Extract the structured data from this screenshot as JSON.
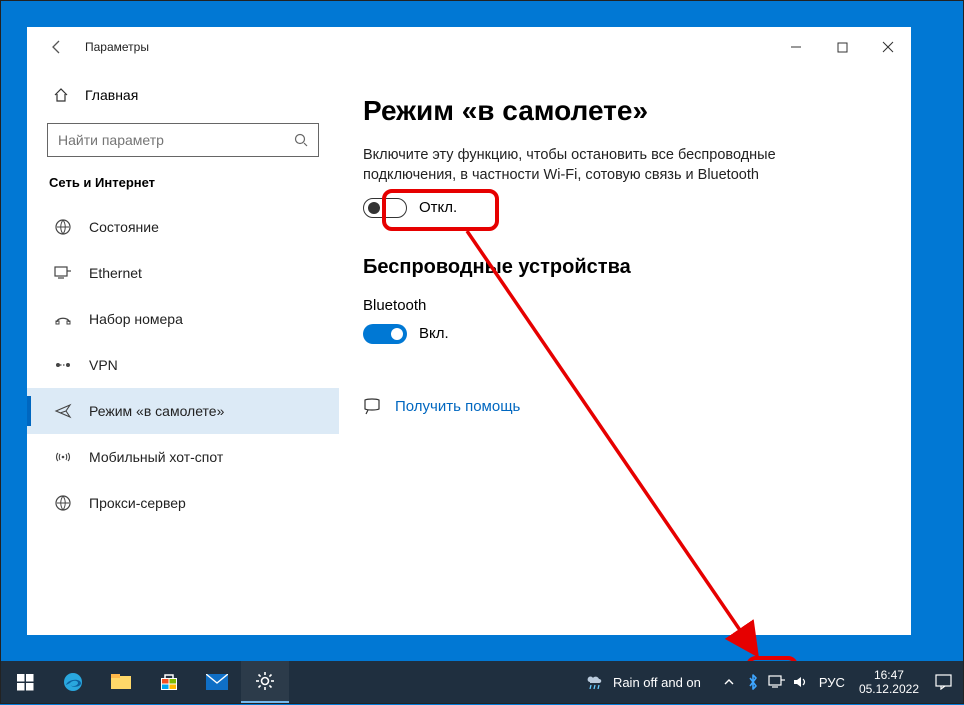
{
  "window": {
    "title": "Параметры"
  },
  "sidebar": {
    "home": "Главная",
    "search_placeholder": "Найти параметр",
    "group": "Сеть и Интернет",
    "items": [
      {
        "label": "Состояние"
      },
      {
        "label": "Ethernet"
      },
      {
        "label": "Набор номера"
      },
      {
        "label": "VPN"
      },
      {
        "label": "Режим «в самолете»"
      },
      {
        "label": "Мобильный хот-спот"
      },
      {
        "label": "Прокси-сервер"
      }
    ]
  },
  "content": {
    "title": "Режим «в самолете»",
    "desc": "Включите эту функцию, чтобы остановить все беспроводные подключения, в частности Wi-Fi, сотовую связь и Bluetooth",
    "airplane_toggle_label": "Откл.",
    "section_wireless": "Беспроводные устройства",
    "bluetooth_label": "Bluetooth",
    "bluetooth_toggle_label": "Вкл.",
    "help_link": "Получить помощь"
  },
  "taskbar": {
    "weather": "Rain off and on",
    "lang": "РУС",
    "time": "16:47",
    "date": "05.12.2022"
  }
}
